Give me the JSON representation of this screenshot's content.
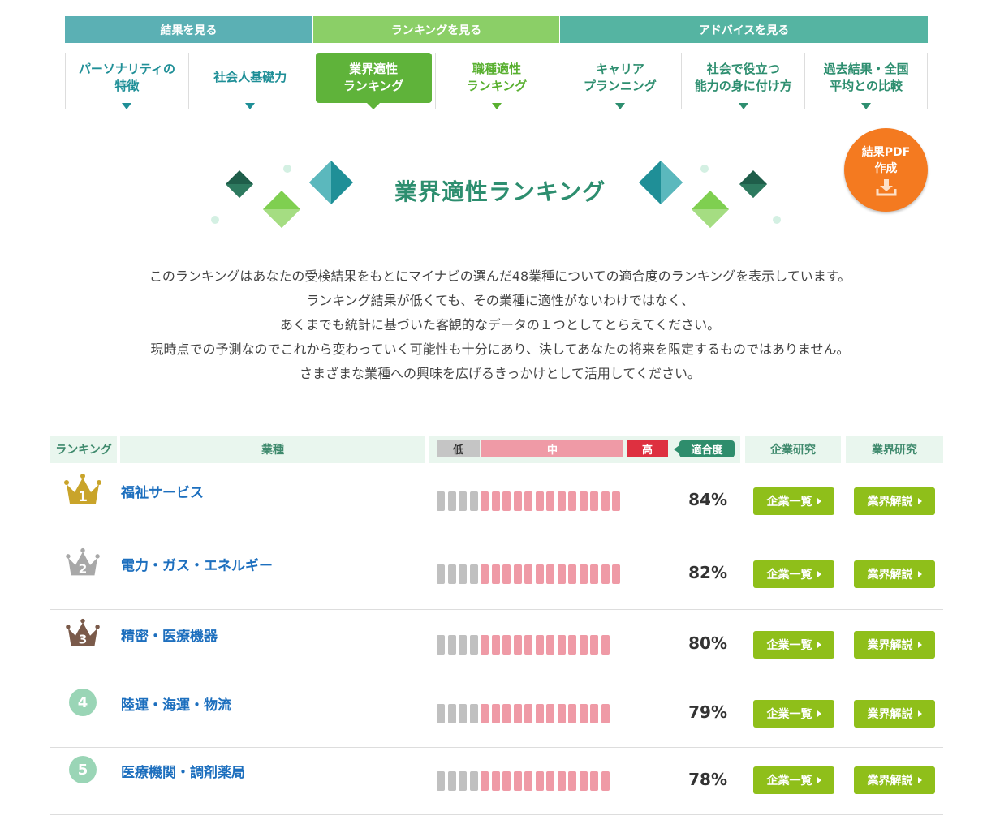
{
  "nav": {
    "categories": [
      "結果を見る",
      "ランキングを見る",
      "アドバイスを見る"
    ],
    "tabs": [
      {
        "label": "パーソナリティの\n特徴"
      },
      {
        "label": "社会人基礎力"
      },
      {
        "label": "業界適性\nランキング"
      },
      {
        "label": "職種適性\nランキング"
      },
      {
        "label": "キャリア\nプランニング"
      },
      {
        "label": "社会で役立つ\n能力の身に付け方"
      },
      {
        "label": "過去結果・全国\n平均との比較"
      }
    ]
  },
  "heading": "業界適性ランキング",
  "pdf_button": {
    "line1": "結果PDF",
    "line2": "作成",
    "icon": "download-icon"
  },
  "description": [
    "このランキングはあなたの受検結果をもとにマイナビの選んだ48業種についての適合度のランキングを表示しています。",
    "ランキング結果が低くても、その業種に適性がないわけではなく、",
    "あくまでも統計に基づいた客観的なデータの１つとしてとらえてください。",
    "現時点での予測なのでこれから変わっていく可能性も十分にあり、決してあなたの将来を限定するものではありません。",
    "さまざまな業種への興味を広げるきっかけとして活用してください。"
  ],
  "table": {
    "headers": {
      "rank": "ランキング",
      "industry": "業種",
      "low": "低",
      "mid": "中",
      "high": "高",
      "fit": "適合度",
      "company": "企業研究",
      "industry_research": "業界研究"
    },
    "company_button": "企業一覧",
    "industry_button": "業界解説",
    "rows": [
      {
        "rank": "1",
        "name": "福祉サービス",
        "percent": "84%",
        "fit_value": 84,
        "badge": "gold-crown-icon",
        "grey_bars": 4,
        "pink_bars": 13
      },
      {
        "rank": "2",
        "name": "電力・ガス・エネルギー",
        "percent": "82%",
        "fit_value": 82,
        "badge": "silver-crown-icon",
        "grey_bars": 4,
        "pink_bars": 13
      },
      {
        "rank": "3",
        "name": "精密・医療機器",
        "percent": "80%",
        "fit_value": 80,
        "badge": "bronze-crown-icon",
        "grey_bars": 4,
        "pink_bars": 12
      },
      {
        "rank": "4",
        "name": "陸運・海運・物流",
        "percent": "79%",
        "fit_value": 79,
        "badge": "rank-circle-icon",
        "grey_bars": 4,
        "pink_bars": 12
      },
      {
        "rank": "5",
        "name": "医療機関・調剤薬局",
        "percent": "78%",
        "fit_value": 78,
        "badge": "rank-circle-icon",
        "grey_bars": 4,
        "pink_bars": 12
      }
    ]
  },
  "colors": {
    "teal": "#5bb0b4",
    "green": "#8bcf67",
    "dark_green": "#2d8e6f",
    "orange": "#f47a20",
    "button_green": "#8fbf1a",
    "link_blue": "#1d6fbe"
  }
}
